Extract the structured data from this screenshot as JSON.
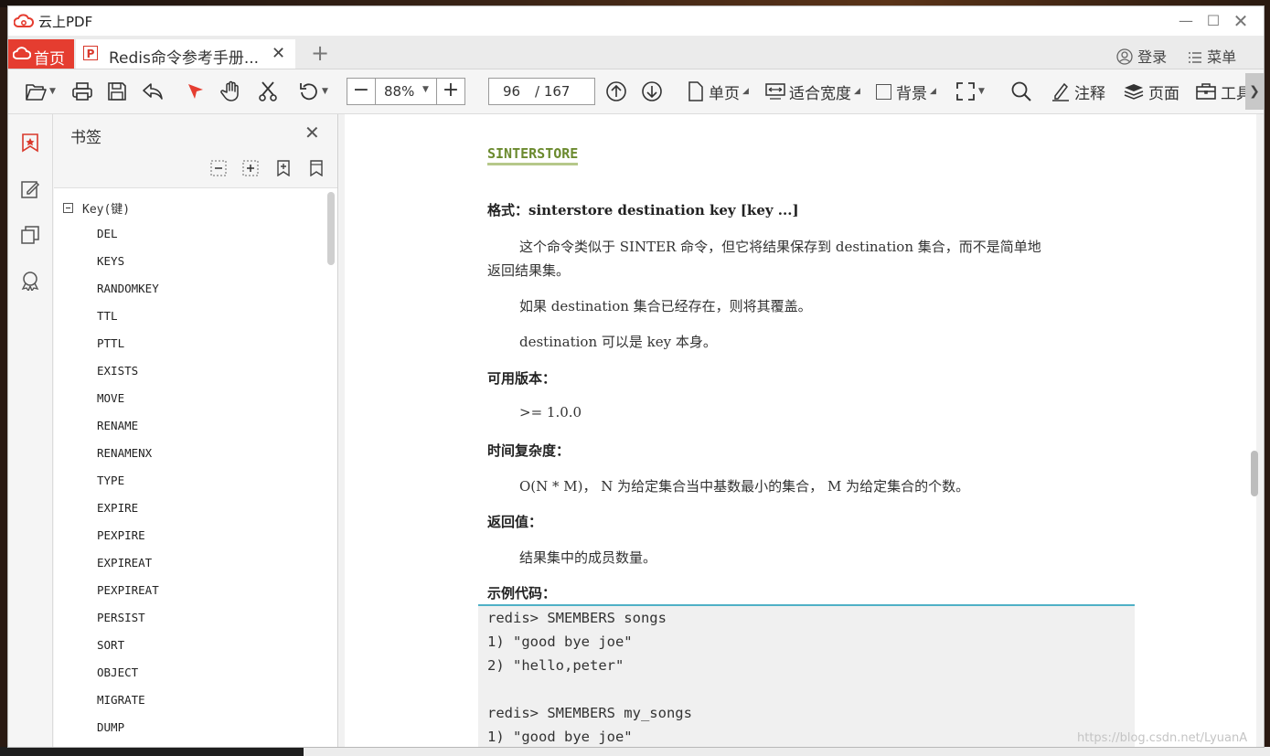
{
  "window": {
    "title": "云上PDF"
  },
  "tabs": {
    "home_label": "首页",
    "doc_label": "Redis命令参考手册..."
  },
  "header_right": {
    "login": "登录",
    "menu": "菜单"
  },
  "toolbar": {
    "zoom_value": "88%",
    "page_current": "96",
    "page_total": "/ 167",
    "single_page": "单页",
    "fit_width": "适合宽度",
    "background": "背景",
    "annotate": "注释",
    "page": "页面",
    "tools": "工具"
  },
  "bookmarks": {
    "title": "书签",
    "root": "Key(键)",
    "items": [
      "DEL",
      "KEYS",
      "RANDOMKEY",
      "TTL",
      "PTTL",
      "EXISTS",
      "MOVE",
      "RENAME",
      "RENAMENX",
      "TYPE",
      "EXPIRE",
      "PEXPIRE",
      "EXPIREAT",
      "PEXPIREAT",
      "PERSIST",
      "SORT",
      "OBJECT",
      "MIGRATE",
      "DUMP"
    ]
  },
  "document": {
    "heading": "SINTERSTORE",
    "format": "格式：sinterstore destination key [key ...]",
    "desc1a": "这个命令类似于 SINTER 命令，但它将结果保存到 destination 集合，而不是简单地",
    "desc1b": "返回结果集。",
    "desc2": "如果 destination 集合已经存在，则将其覆盖。",
    "desc3": "destination 可以是 key 本身。",
    "version_label": "可用版本：",
    "version": ">= 1.0.0",
    "complexity_label": "时间复杂度：",
    "complexity": "O(N * M)， N 为给定集合当中基数最小的集合， M 为给定集合的个数。",
    "return_label": "返回值：",
    "return": "结果集中的成员数量。",
    "example_label": "示例代码：",
    "code": [
      "redis> SMEMBERS songs",
      "1) \"good bye joe\"",
      "2) \"hello,peter\"",
      "",
      "redis> SMEMBERS my_songs",
      "1) \"good bye joe\""
    ]
  },
  "watermark": "https://blog.csdn.net/LyuanA",
  "colors": {
    "accent_red": "#e53d30",
    "heading_green": "#6b8a2e",
    "code_border": "#4fb0c6"
  }
}
